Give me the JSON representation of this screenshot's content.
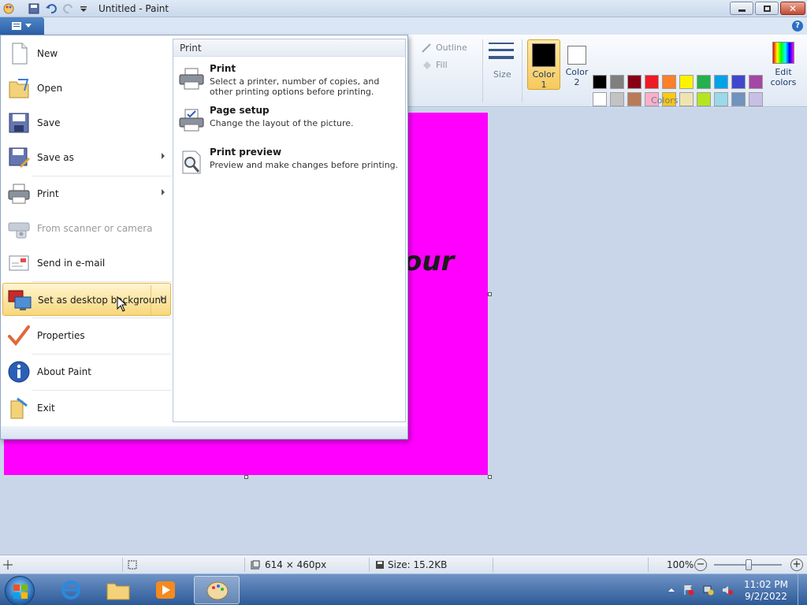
{
  "window": {
    "title": "Untitled - Paint"
  },
  "ribbon": {
    "outline_label": "Outline",
    "fill_label": "Fill",
    "size_label": "Size",
    "color1_label_line1": "Color",
    "color1_label_line2": "1",
    "color2_label_line1": "Color",
    "color2_label_line2": "2",
    "edit_colors_line1": "Edit",
    "edit_colors_line2": "colors",
    "colors_group_label": "Colors",
    "color1_value": "#000000",
    "color2_value": "#ffffff",
    "palette": [
      "#000000",
      "#7f7f7f",
      "#880015",
      "#ed1c24",
      "#ff7f27",
      "#fff200",
      "#22b14c",
      "#00a2e8",
      "#3f48cc",
      "#a349a4",
      "#ffffff",
      "#c3c3c3",
      "#b97a57",
      "#ffaec9",
      "#ffc90e",
      "#efe4b0",
      "#b5e61d",
      "#99d9ea",
      "#7092be",
      "#c8bfe7",
      "#ff00ff",
      "",
      "",
      "",
      "",
      "",
      "",
      "",
      "",
      ""
    ]
  },
  "canvas": {
    "color": "#ff00ff",
    "text": "our"
  },
  "app_menu": {
    "items": [
      {
        "name": "new",
        "label": "New"
      },
      {
        "name": "open",
        "label": "Open"
      },
      {
        "name": "save",
        "label": "Save"
      },
      {
        "name": "save-as",
        "label": "Save as",
        "submenu": true
      },
      {
        "name": "print",
        "label": "Print",
        "submenu": true
      },
      {
        "name": "from-scanner",
        "label": "From scanner or camera",
        "disabled": true
      },
      {
        "name": "send-email",
        "label": "Send in e-mail"
      },
      {
        "name": "set-desktop-background",
        "label": "Set as desktop background",
        "submenu": true,
        "hover": true
      },
      {
        "name": "properties",
        "label": "Properties"
      },
      {
        "name": "about-paint",
        "label": "About Paint"
      },
      {
        "name": "exit",
        "label": "Exit"
      }
    ],
    "submenu": {
      "header": "Print",
      "items": [
        {
          "title": "Print",
          "desc": "Select a printer, number of copies, and other printing options before printing."
        },
        {
          "title": "Page setup",
          "desc": "Change the layout of the picture."
        },
        {
          "title": "Print preview",
          "desc": "Preview and make changes before printing."
        }
      ]
    }
  },
  "statusbar": {
    "dimensions": "614 × 460px",
    "size": "Size: 15.2KB",
    "zoom": "100%"
  },
  "taskbar": {
    "time": "11:02 PM",
    "date": "9/2/2022"
  }
}
